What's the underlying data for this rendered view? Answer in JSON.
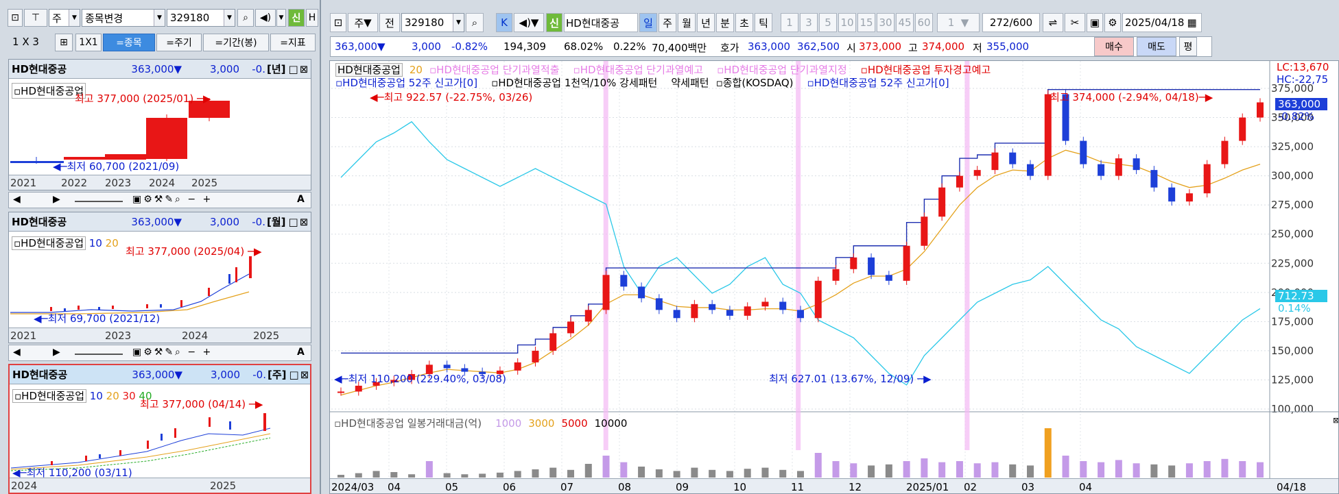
{
  "colors": {
    "up": "#e81616",
    "down": "#1d3fd8",
    "accent": "#0a1fd0",
    "selected": "#9fc4ef",
    "ma5": "#e4a11b",
    "kosdaq": "#2ac8e8"
  },
  "left": {
    "toolbar": {
      "type": "주",
      "stock_change": "종목변경",
      "code": "329180",
      "sin": "신",
      "hd": "H"
    },
    "layout": {
      "n1": "1",
      "x": "X",
      "n3": "3",
      "grid1x1": "1X1",
      "tab_stock": "=종목",
      "tab_period": "=주기",
      "tab_range": "=기간(봉)",
      "tab_index": "=지표"
    },
    "panels": [
      {
        "name": "HD현대중공",
        "price": "363,000▼",
        "change": "3,000",
        "pct": "-0.",
        "period": "[년]",
        "legend": "HD현대중공업",
        "high": "최고 377,000 (2025/01)",
        "low": "최저 60,700 (2021/09)",
        "axis": [
          "2021",
          "2022",
          "2023",
          "2024",
          "2025"
        ]
      },
      {
        "name": "HD현대중공",
        "price": "363,000▼",
        "change": "3,000",
        "pct": "-0.",
        "period": "[월]",
        "legend": "HD현대중공업",
        "ma": [
          "10",
          "20"
        ],
        "high": "최고 377,000 (2025/04)",
        "low": "최저 69,700 (2021/12)",
        "axis": [
          "2021",
          "2023",
          "2024",
          "2025"
        ]
      },
      {
        "name": "HD현대중공",
        "price": "363,000▼",
        "change": "3,000",
        "pct": "-0.",
        "period": "[주]",
        "legend": "HD현대중공업",
        "ma": [
          "10",
          "20",
          "30",
          "40"
        ],
        "high": "최고 377,000 (04/14)",
        "low": "최저 110,200 (03/11)",
        "axis": [
          "2024",
          "2025"
        ]
      }
    ],
    "scroll_a": "A"
  },
  "main": {
    "toolbar": {
      "type": "주",
      "prev": "전",
      "code": "329180",
      "k": "K",
      "sin": "신",
      "name": "HD현대중공",
      "periods": [
        "일",
        "주",
        "월",
        "년",
        "분",
        "초",
        "틱"
      ],
      "nums": [
        "1",
        "3",
        "5",
        "10",
        "15",
        "30",
        "45",
        "60"
      ],
      "unit": "1",
      "count": "272",
      "total": "/600",
      "date": "2025/04/18"
    },
    "quote": {
      "price": "363,000▼",
      "change": "3,000",
      "pct": "-0.82%",
      "volume": "194,309",
      "ratio1": "68.02%",
      "ratio2": "0.22%",
      "amount": "70,400백만",
      "hoga_label": "호가",
      "ask": "363,000",
      "bid": "362,500",
      "open_label": "시",
      "open": "373,000",
      "high_label": "고",
      "high": "374,000",
      "low_label": "저",
      "low": "355,000",
      "buy": "매수",
      "sell": "매도",
      "avg": "평"
    },
    "legend1": [
      "HD현대중공업",
      "20",
      "HD현대중공업 단기과열적출",
      "HD현대중공업 단기과열예고",
      "HD현대중공업 단기과열지정",
      "HD현대중공업 투자경고예고"
    ],
    "legend2": [
      "HD현대중공업 52주 신고가[0]",
      "HD현대중공업 1천억/10% 강세패턴",
      "약세패턴",
      "종합(KOSDAQ)",
      "HD현대중공업 52주 신고가[0]"
    ],
    "ann": {
      "kosdaq_high": "최고 922.57 (-22.75%, 03/26)",
      "price_high": "최고 374,000 (-2.94%, 04/18)",
      "price_low": "최저 110,200 (229.40%, 03/08)",
      "kosdaq_low": "최저 627.01 (13.67%, 12/09)"
    },
    "right": {
      "lc": "LC:13,670",
      "hc": "HC:-22,75",
      "cur": "363,000",
      "curpct": "-0.82%",
      "kosdaq": "712.73",
      "kosdaqpct": "0.14%"
    },
    "vol_legend": [
      "HD현대중공업 일봉거래대금(억)",
      "1000",
      "3000",
      "5000",
      "10000"
    ],
    "x_labels": [
      "2024/03",
      "04",
      "05",
      "06",
      "07",
      "08",
      "09",
      "10",
      "11",
      "12",
      "2025/01",
      "02",
      "03",
      "04"
    ],
    "x_right": "04/18"
  },
  "chart_data": {
    "type": "line",
    "title": "",
    "xlabel": "",
    "ylabel": "",
    "ylim": [
      100000,
      375000
    ],
    "y_ticks": [
      100000,
      125000,
      150000,
      175000,
      200000,
      225000,
      250000,
      275000,
      300000,
      325000,
      350000,
      375000
    ],
    "y_tick_labels": [
      "100,000",
      "125,000",
      "150,000",
      "175,000",
      "200,000",
      "225,000",
      "250,000",
      "275,000",
      "300,000",
      "325,000",
      "350,000",
      "375,000"
    ],
    "series": [
      {
        "name": "HD현대중공업",
        "values": [
          115000,
          120000,
          123000,
          125000,
          130000,
          138000,
          135000,
          132000,
          130000,
          133000,
          140000,
          150000,
          165000,
          175000,
          185000,
          215000,
          205000,
          195000,
          185000,
          178000,
          190000,
          185000,
          180000,
          188000,
          192000,
          185000,
          178000,
          210000,
          220000,
          230000,
          215000,
          210000,
          240000,
          265000,
          290000,
          300000,
          305000,
          320000,
          310000,
          300000,
          370000,
          330000,
          310000,
          300000,
          315000,
          305000,
          290000,
          278000,
          285000,
          310000,
          330000,
          350000,
          363000
        ]
      },
      {
        "name": "20",
        "values": [
          112000,
          116000,
          120000,
          123000,
          127000,
          131000,
          134000,
          133000,
          132000,
          131000,
          134000,
          140000,
          150000,
          160000,
          172000,
          190000,
          198000,
          198000,
          193000,
          188000,
          187000,
          187000,
          185000,
          185000,
          186000,
          186000,
          184000,
          190000,
          198000,
          208000,
          214000,
          214000,
          220000,
          235000,
          255000,
          275000,
          290000,
          300000,
          305000,
          304000,
          315000,
          322000,
          318000,
          312000,
          310000,
          308000,
          302000,
          295000,
          290000,
          292000,
          298000,
          305000,
          310000
        ]
      },
      {
        "name": "HD현대중공업 52주 신고가[0]",
        "values": [
          148000,
          148000,
          148000,
          148000,
          148000,
          148000,
          148000,
          148000,
          148000,
          148000,
          155000,
          160000,
          170000,
          180000,
          190000,
          221000,
          221000,
          221000,
          221000,
          221000,
          221000,
          221000,
          221000,
          221000,
          221000,
          221000,
          221000,
          221000,
          230000,
          240000,
          240000,
          240000,
          260000,
          280000,
          300000,
          315000,
          318000,
          328000,
          328000,
          328000,
          374000,
          374000,
          374000,
          374000,
          374000,
          374000,
          374000,
          374000,
          374000,
          374000,
          374000,
          374000,
          374000
        ]
      },
      {
        "name": "종합(KOSDAQ)",
        "values": [
          860,
          880,
          900,
          910,
          922.57,
          900,
          880,
          870,
          860,
          850,
          860,
          870,
          860,
          850,
          840,
          830,
          760,
          730,
          760,
          770,
          750,
          730,
          740,
          760,
          770,
          740,
          730,
          700,
          690,
          680,
          660,
          640,
          627.01,
          660,
          680,
          700,
          720,
          730,
          740,
          745,
          760,
          740,
          720,
          700,
          690,
          670,
          660,
          650,
          640,
          660,
          680,
          700,
          712.73
        ]
      }
    ],
    "volume": [
      5,
      8,
      12,
      10,
      6,
      30,
      8,
      6,
      7,
      9,
      12,
      15,
      18,
      14,
      25,
      40,
      28,
      20,
      15,
      12,
      18,
      14,
      12,
      16,
      18,
      14,
      12,
      45,
      30,
      26,
      22,
      24,
      30,
      35,
      28,
      30,
      26,
      28,
      24,
      22,
      90,
      40,
      30,
      28,
      32,
      26,
      24,
      22,
      26,
      30,
      34,
      30,
      28
    ]
  }
}
